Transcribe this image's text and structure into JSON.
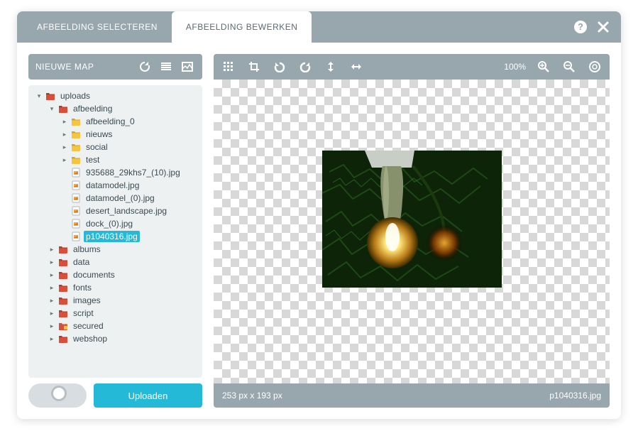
{
  "header": {
    "tabs": [
      {
        "label": "AFBEELDING SELECTEREN",
        "active": false
      },
      {
        "label": "AFBEELDING BEWERKEN",
        "active": true
      }
    ]
  },
  "sidebar": {
    "title": "NIEUWE MAP",
    "upload_label": "Uploaden",
    "tree": [
      {
        "depth": 0,
        "arrow": "down",
        "icon": "folder-red",
        "label": "uploads"
      },
      {
        "depth": 1,
        "arrow": "down",
        "icon": "folder-red",
        "label": "afbeelding"
      },
      {
        "depth": 2,
        "arrow": "right",
        "icon": "folder-yellow",
        "label": "afbeelding_0"
      },
      {
        "depth": 2,
        "arrow": "right",
        "icon": "folder-yellow",
        "label": "nieuws"
      },
      {
        "depth": 2,
        "arrow": "right",
        "icon": "folder-yellow",
        "label": "social"
      },
      {
        "depth": 2,
        "arrow": "right",
        "icon": "folder-yellow",
        "label": "test"
      },
      {
        "depth": 2,
        "arrow": "",
        "icon": "file",
        "label": "935688_29khs7_(10).jpg"
      },
      {
        "depth": 2,
        "arrow": "",
        "icon": "file",
        "label": "datamodel.jpg"
      },
      {
        "depth": 2,
        "arrow": "",
        "icon": "file",
        "label": "datamodel_(0).jpg"
      },
      {
        "depth": 2,
        "arrow": "",
        "icon": "file",
        "label": "desert_landscape.jpg"
      },
      {
        "depth": 2,
        "arrow": "",
        "icon": "file",
        "label": "dock_(0).jpg"
      },
      {
        "depth": 2,
        "arrow": "",
        "icon": "file",
        "label": "p1040316.jpg",
        "selected": true
      },
      {
        "depth": 1,
        "arrow": "right",
        "icon": "folder-red",
        "label": "albums"
      },
      {
        "depth": 1,
        "arrow": "right",
        "icon": "folder-red",
        "label": "data"
      },
      {
        "depth": 1,
        "arrow": "right",
        "icon": "folder-red",
        "label": "documents"
      },
      {
        "depth": 1,
        "arrow": "right",
        "icon": "folder-red",
        "label": "fonts"
      },
      {
        "depth": 1,
        "arrow": "right",
        "icon": "folder-red",
        "label": "images"
      },
      {
        "depth": 1,
        "arrow": "right",
        "icon": "folder-red",
        "label": "script"
      },
      {
        "depth": 1,
        "arrow": "right",
        "icon": "folder-red-lock",
        "label": "secured"
      },
      {
        "depth": 1,
        "arrow": "right",
        "icon": "folder-red",
        "label": "webshop"
      }
    ]
  },
  "toolbar": {
    "zoom": "100%"
  },
  "status": {
    "dimensions": "253 px  x  193 px",
    "filename": "p1040316.jpg"
  }
}
